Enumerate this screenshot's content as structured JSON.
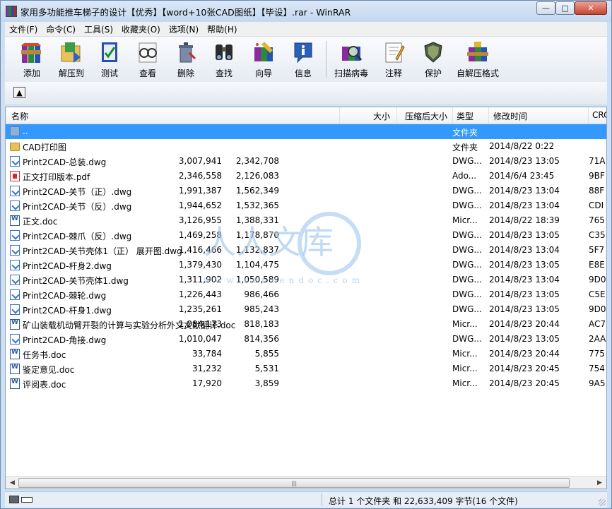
{
  "window": {
    "title": "家用多功能推车梯子的设计【优秀】【word+10张CAD图纸】【毕设】.rar - WinRAR",
    "min_label": "—",
    "max_label": "□",
    "close_label": "✕"
  },
  "menu": [
    "文件(F)",
    "命令(C)",
    "工具(S)",
    "收藏夹(O)",
    "选项(N)",
    "帮助(H)"
  ],
  "toolbar": [
    {
      "label": "添加",
      "icon": "add-archive-icon"
    },
    {
      "label": "解压到",
      "icon": "extract-to-icon"
    },
    {
      "label": "测试",
      "icon": "test-icon"
    },
    {
      "label": "查看",
      "icon": "view-icon"
    },
    {
      "label": "删除",
      "icon": "delete-icon"
    },
    {
      "label": "查找",
      "icon": "find-icon"
    },
    {
      "label": "向导",
      "icon": "wizard-icon"
    },
    {
      "label": "信息",
      "icon": "info-icon"
    },
    {
      "label": "扫描病毒",
      "icon": "virus-scan-icon"
    },
    {
      "label": "注释",
      "icon": "comment-icon"
    },
    {
      "label": "保护",
      "icon": "protect-icon"
    },
    {
      "label": "自解压格式",
      "icon": "sfx-icon"
    }
  ],
  "columns": {
    "name": "名称",
    "size": "大小",
    "packed": "压缩后大小",
    "type": "类型",
    "modified": "修改时间",
    "crc": "CRC"
  },
  "files": [
    {
      "name": "..",
      "size": "",
      "packed": "",
      "type": "文件夹",
      "modified": "",
      "crc": "",
      "icon": "parent",
      "selected": true
    },
    {
      "name": "CAD打印图",
      "size": "",
      "packed": "",
      "type": "文件夹",
      "modified": "2014/8/22 0:22",
      "crc": "",
      "icon": "folder"
    },
    {
      "name": "Print2CAD-总装.dwg",
      "size": "3,007,941",
      "packed": "2,342,708",
      "type": "DWG...",
      "modified": "2014/8/23 13:05",
      "crc": "71A",
      "icon": "dwg"
    },
    {
      "name": "正文打印版本.pdf",
      "size": "2,346,558",
      "packed": "2,126,083",
      "type": "Ado...",
      "modified": "2014/6/4 23:45",
      "crc": "9BF",
      "icon": "pdf"
    },
    {
      "name": "Print2CAD-关节（正）.dwg",
      "size": "1,991,387",
      "packed": "1,562,349",
      "type": "DWG...",
      "modified": "2014/8/23 13:04",
      "crc": "88F",
      "icon": "dwg"
    },
    {
      "name": "Print2CAD-关节（反）.dwg",
      "size": "1,944,652",
      "packed": "1,532,365",
      "type": "DWG...",
      "modified": "2014/8/23 13:04",
      "crc": "CDI",
      "icon": "dwg"
    },
    {
      "name": "正文.doc",
      "size": "3,126,955",
      "packed": "1,388,331",
      "type": "Micr...",
      "modified": "2014/8/22 18:39",
      "crc": "765",
      "icon": "doc"
    },
    {
      "name": "Print2CAD-棘爪（反）.dwg",
      "size": "1,469,258",
      "packed": "1,178,870",
      "type": "DWG...",
      "modified": "2014/8/23 13:05",
      "crc": "C35",
      "icon": "dwg"
    },
    {
      "name": "Print2CAD-关节壳体1（正） 展开图.dwg",
      "size": "1,416,466",
      "packed": "1,132,837",
      "type": "DWG...",
      "modified": "2014/8/23 13:04",
      "crc": "5F7",
      "icon": "dwg"
    },
    {
      "name": "Print2CAD-杆身2.dwg",
      "size": "1,379,430",
      "packed": "1,104,475",
      "type": "DWG...",
      "modified": "2014/8/23 13:05",
      "crc": "E8E",
      "icon": "dwg"
    },
    {
      "name": "Print2CAD-关节壳体1.dwg",
      "size": "1,311,902",
      "packed": "1,050,589",
      "type": "DWG...",
      "modified": "2014/8/23 13:04",
      "crc": "9D0",
      "icon": "dwg"
    },
    {
      "name": "Print2CAD-棘轮.dwg",
      "size": "1,226,443",
      "packed": "986,466",
      "type": "DWG...",
      "modified": "2014/8/23 13:05",
      "crc": "C5E",
      "icon": "dwg"
    },
    {
      "name": "Print2CAD-杆身1.dwg",
      "size": "1,235,261",
      "packed": "985,243",
      "type": "DWG...",
      "modified": "2014/8/23 13:05",
      "crc": "9D0",
      "icon": "dwg"
    },
    {
      "name": "矿山装载机动臂开裂的计算与实验分析外文文献翻译.doc",
      "size": "1,084,173",
      "packed": "818,183",
      "type": "Micr...",
      "modified": "2014/8/23 20:44",
      "crc": "AC7",
      "icon": "doc"
    },
    {
      "name": "Print2CAD-角接.dwg",
      "size": "1,010,047",
      "packed": "814,356",
      "type": "DWG...",
      "modified": "2014/8/23 13:05",
      "crc": "2AA",
      "icon": "dwg"
    },
    {
      "name": "任务书.doc",
      "size": "33,784",
      "packed": "5,855",
      "type": "Micr...",
      "modified": "2014/8/23 20:44",
      "crc": "775",
      "icon": "doc"
    },
    {
      "name": "鉴定意见.doc",
      "size": "31,232",
      "packed": "5,531",
      "type": "Micr...",
      "modified": "2014/8/23 20:45",
      "crc": "754",
      "icon": "doc"
    },
    {
      "name": "评阅表.doc",
      "size": "17,920",
      "packed": "3,859",
      "type": "Micr...",
      "modified": "2014/8/23 20:45",
      "crc": "9A5",
      "icon": "doc"
    }
  ],
  "watermark": {
    "big": "人人文库",
    "url": "www.renrendoc.com"
  },
  "status": {
    "summary": "总计 1 个文件夹 和 22,633,409 字节(16 个文件)"
  },
  "colors": {
    "selection": "#3399ff",
    "titlebar": "#c4d8ef"
  }
}
